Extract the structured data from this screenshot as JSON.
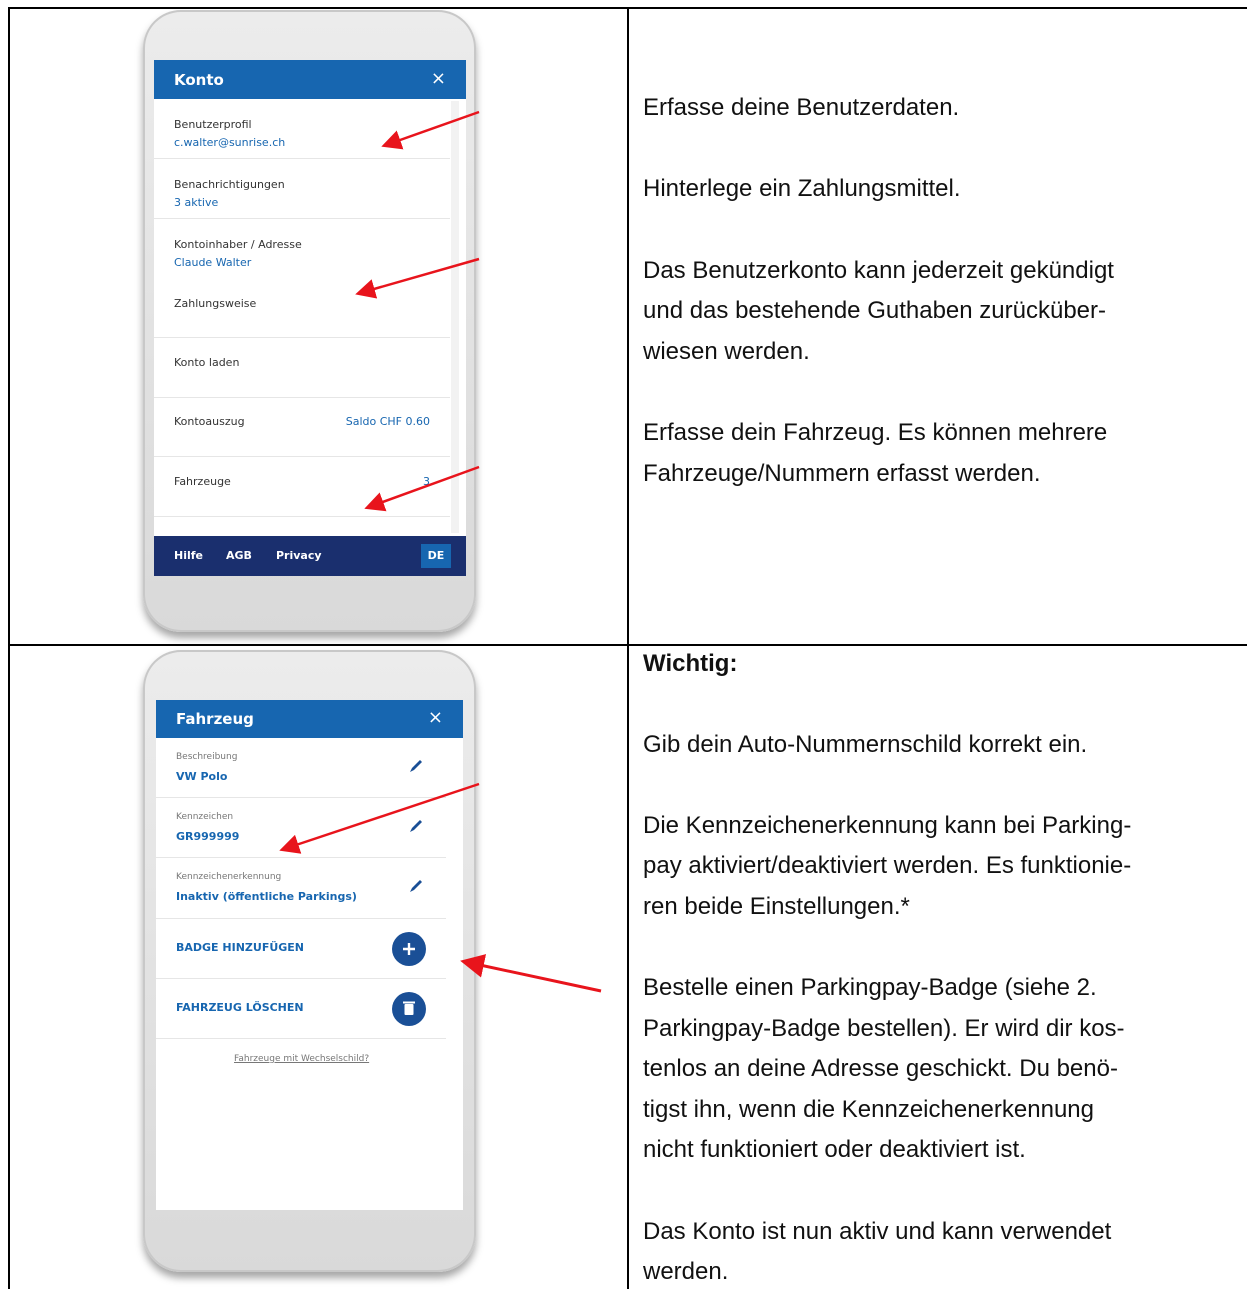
{
  "konto_screen": {
    "title": "Konto",
    "close_symbol": "×",
    "rows": [
      {
        "label": "Benutzerprofil",
        "value": "c.walter@sunrise.ch"
      },
      {
        "label": "Benachrichtigungen",
        "value": "3 aktive"
      },
      {
        "label": "Kontoinhaber / Adresse",
        "value": "Claude Walter"
      },
      {
        "label": "Zahlungsweise",
        "value": ""
      },
      {
        "label": "Konto laden",
        "value": ""
      },
      {
        "label": "Kontoauszug",
        "value": "Saldo CHF 0.60"
      },
      {
        "label": "Fahrzeuge",
        "value": "3"
      }
    ],
    "footer": {
      "help": "Hilfe",
      "agb": "AGB",
      "privacy": "Privacy",
      "language": "DE"
    }
  },
  "fahrzeug_screen": {
    "title": "Fahrzeug",
    "close_symbol": "×",
    "fields": [
      {
        "label": "Beschreibung",
        "value": "VW Polo"
      },
      {
        "label": "Kennzeichen",
        "value": "GR999999"
      },
      {
        "label": "Kennzeichenerkennung",
        "value": "Inaktiv (öffentliche Parkings)"
      }
    ],
    "actions": {
      "add_badge": "BADGE HINZUFÜGEN",
      "delete_vehicle": "FAHRZEUG LÖSCHEN"
    },
    "link": "Fahrzeuge mit Wechselschild?"
  },
  "text_row1": [
    "Erfasse deine Benutzerdaten.",
    "Hinterlege ein Zahlungsmittel.",
    "Das Benutzerkonto kann jederzeit gekündigt",
    "und das bestehende Guthaben zurücküber-",
    "wiesen werden.",
    "Erfasse dein Fahrzeug. Es können mehrere",
    "Fahrzeuge/Nummern erfasst werden."
  ],
  "text_row2": {
    "heading": "Wichtig:",
    "lines": [
      "Gib dein Auto-Nummernschild korrekt ein.",
      "Die Kennzeichenerkennung kann bei Parking-",
      "pay aktiviert/deaktiviert werden. Es funktionie-",
      "ren beide Einstellungen.*",
      "Bestelle einen Parkingpay-Badge (siehe 2.",
      "Parkingpay-Badge bestellen). Er wird dir kos-",
      "tenlos an deine Adresse geschickt. Du benö-",
      "tigst ihn, wenn die Kennzeichenerkennung",
      "nicht funktioniert oder deaktiviert ist.",
      "Das Konto ist nun aktiv und kann verwendet",
      "werden."
    ]
  },
  "colors": {
    "brand_blue": "#1766b0",
    "footer_navy": "#1a2f6e",
    "arrow_red": "#e8141c"
  }
}
